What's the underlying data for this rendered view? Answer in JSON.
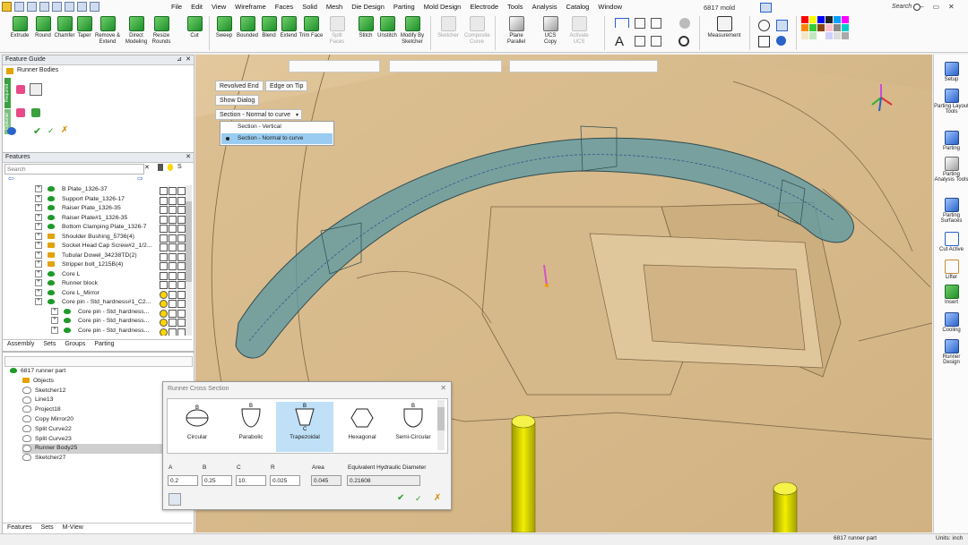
{
  "menu": [
    "File",
    "Edit",
    "View",
    "Wireframe",
    "Faces",
    "Solid",
    "Mesh",
    "Die Design",
    "Parting",
    "Mold Design",
    "Electrode",
    "Tools",
    "Analysis",
    "Catalog",
    "Window"
  ],
  "title": "6817 mold",
  "search_label": "Search",
  "window_controls": [
    "–",
    "▭",
    "✕"
  ],
  "ribbon": {
    "solid": [
      "Extrude",
      "Round",
      "Chamfer",
      "Taper",
      "Remove & Extend",
      "Direct Modeling",
      "Resize Rounds",
      "Cut"
    ],
    "surface": [
      "Sweep",
      "Bounded",
      "Blend",
      "Extend",
      "Trim Face",
      "Split Faces",
      "Stitch",
      "Unstitch",
      "Modify By Sketcher"
    ],
    "sketch": [
      "Sketcher",
      "Composite Curve",
      "Plane Parallel",
      "UCS Copy",
      "Activate UCS"
    ],
    "measure": "Measurement"
  },
  "feature_guide": {
    "title": "Feature Guide",
    "item": "Runner Bodies",
    "required": "Required",
    "optional": "Optional"
  },
  "features": {
    "title": "Features",
    "search_placeholder": "Search",
    "rows": [
      {
        "label": "B Plate_1326-37",
        "kind": "solid",
        "yellow": false
      },
      {
        "label": "Support Plate_1326-17",
        "kind": "solid",
        "yellow": false
      },
      {
        "label": "Raiser Plate_1326-35",
        "kind": "solid",
        "yellow": false
      },
      {
        "label": "Raiser Plate#1_1326-35",
        "kind": "solid",
        "yellow": false
      },
      {
        "label": "Bottom Clamping Plate_1326-7",
        "kind": "solid",
        "yellow": false
      },
      {
        "label": "Shoulder Bushing_5736(4)",
        "kind": "folder",
        "yellow": false
      },
      {
        "label": "Socket Head Cap Screw#2_1/2...",
        "kind": "folder",
        "yellow": false
      },
      {
        "label": "Tubular Dowel_34238TD(2)",
        "kind": "folder",
        "yellow": false
      },
      {
        "label": "Stripper bolt_1215B(4)",
        "kind": "folder",
        "yellow": false
      },
      {
        "label": "Core L",
        "kind": "solid",
        "yellow": false
      },
      {
        "label": "Runner block",
        "kind": "solid",
        "yellow": false
      },
      {
        "label": "Core L_Mirror",
        "kind": "solid",
        "yellow": true
      },
      {
        "label": "Core pin - Std_hardness#1_C2...",
        "kind": "solid",
        "yellow": true
      },
      {
        "label": "Core pin - Std_hardness...",
        "kind": "solid",
        "yellow": true
      },
      {
        "label": "Core pin - Std_hardness...",
        "kind": "solid",
        "yellow": true
      },
      {
        "label": "Core pin - Std_hardness...",
        "kind": "solid",
        "yellow": true
      }
    ],
    "tabs": [
      "Assembly",
      "Sets",
      "Groups",
      "Parting"
    ]
  },
  "part_tree": {
    "rows": [
      {
        "label": "6817 runner part",
        "indent": 0,
        "sel": false
      },
      {
        "label": "Objects",
        "indent": 1,
        "sel": false
      },
      {
        "label": "Sketcher12",
        "indent": 1,
        "sel": false
      },
      {
        "label": "Line13",
        "indent": 1,
        "sel": false
      },
      {
        "label": "Project18",
        "indent": 1,
        "sel": false
      },
      {
        "label": "Copy Mirror20",
        "indent": 1,
        "sel": false
      },
      {
        "label": "Split Curve22",
        "indent": 1,
        "sel": false
      },
      {
        "label": "Split Curve23",
        "indent": 1,
        "sel": false
      },
      {
        "label": "Runner Body25",
        "indent": 1,
        "sel": true
      },
      {
        "label": "Sketcher27",
        "indent": 1,
        "sel": false
      }
    ],
    "tabs": [
      "Features",
      "Sets",
      "M-View"
    ]
  },
  "viewport_buttons": {
    "revolved_end": "Revolved End",
    "edge_on_tip": "Edge on Tip",
    "show_dialog": "Show Dialog",
    "section_select": "Section - Normal to curve",
    "options": [
      "Section - Vertical",
      "Section - Normal to curve"
    ]
  },
  "right_tools": [
    "Setup",
    "Parting Layout Tools",
    "Parting",
    "Parting Analysis Tools",
    "Parting Surfaces",
    "Cut Active",
    "Lifter",
    "Insert",
    "Cooling",
    "Runner Design"
  ],
  "dialog": {
    "title": "Runner Cross Section",
    "sections": [
      "Circular",
      "Parabolic",
      "Trapezoidal",
      "Hexagonal",
      "Semi-Circular"
    ],
    "selected": "Trapezoidal",
    "labels": {
      "a": "A",
      "b": "B",
      "c": "C",
      "r": "R",
      "area": "Area",
      "ehd": "Equivalent Hydraulic Diameter"
    },
    "values": {
      "a": "0.2",
      "b": "0.25",
      "c": "10.",
      "r": "0.025",
      "area": "0.045",
      "ehd": "0.21608"
    }
  },
  "status": {
    "part": "6817 runner part",
    "units": "Units: inch"
  },
  "colors": {
    "mold": "#cfb184",
    "runner": "#5f9aa3",
    "pin": "#e3e000"
  }
}
